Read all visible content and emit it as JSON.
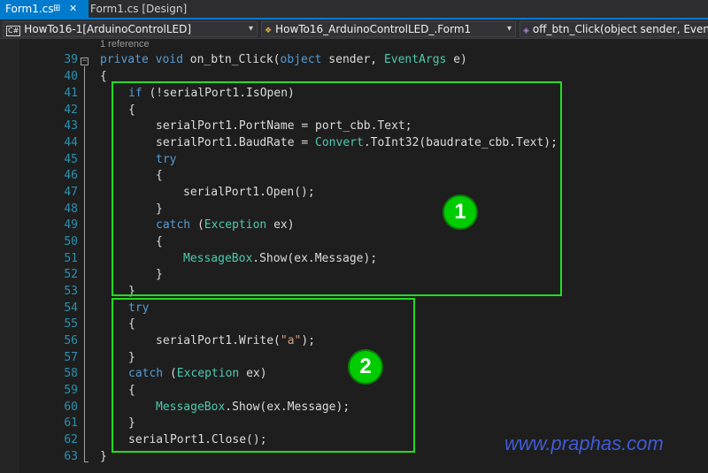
{
  "tabs": [
    {
      "label": "Form1.cs",
      "pin": "⊞",
      "close": "✕"
    },
    {
      "label": "Form1.cs [Design]"
    }
  ],
  "nav": {
    "project": "HowTo16-1[ArduinoControlLED]",
    "class": "HowTo16_ArduinoControlLED_.Form1",
    "member": "off_btn_Click(object sender, EventArgs e)"
  },
  "editor": {
    "reference_hint": "1 reference",
    "line_numbers": [
      "39",
      "40",
      "41",
      "42",
      "43",
      "44",
      "45",
      "46",
      "47",
      "48",
      "49",
      "50",
      "51",
      "52",
      "53",
      "54",
      "55",
      "56",
      "57",
      "58",
      "59",
      "60",
      "61",
      "62",
      "63"
    ],
    "tokens": {
      "private": "private",
      "void": "void",
      "method": " on_btn_Click(",
      "object": "object",
      "sender": " sender, ",
      "EventArgs": "EventArgs",
      "e_close": " e)",
      "open_brace": "{",
      "close_brace": "}",
      "if": "if",
      "if_cond": " (!serialPort1.IsOpen)",
      "portname": "serialPort1.PortName = port_cbb.Text;",
      "baud_pre": "serialPort1.BaudRate = ",
      "Convert": "Convert",
      "baud_post": ".ToInt32(baudrate_cbb.Text);",
      "try": "try",
      "open_call": "serialPort1.Open();",
      "catch": "catch",
      "paren_open": " (",
      "Exception": "Exception",
      "ex_close": " ex)",
      "MessageBox": "MessageBox",
      "show_call": ".Show(ex.Message);",
      "write_pre": "serialPort1.Write(",
      "write_arg": "\"a\"",
      "write_post": ");",
      "close_call": "serialPort1.Close();"
    }
  },
  "annotations": {
    "badge1": "1",
    "badge2": "2"
  },
  "watermark": "www.praphas.com",
  "colors": {
    "keyword": "#569cd6",
    "type": "#4ec9b0",
    "string": "#d69d85",
    "text": "#dcdcdc",
    "line_number": "#2b91af",
    "highlight_box": "#22dd22",
    "accent": "#007acc"
  }
}
